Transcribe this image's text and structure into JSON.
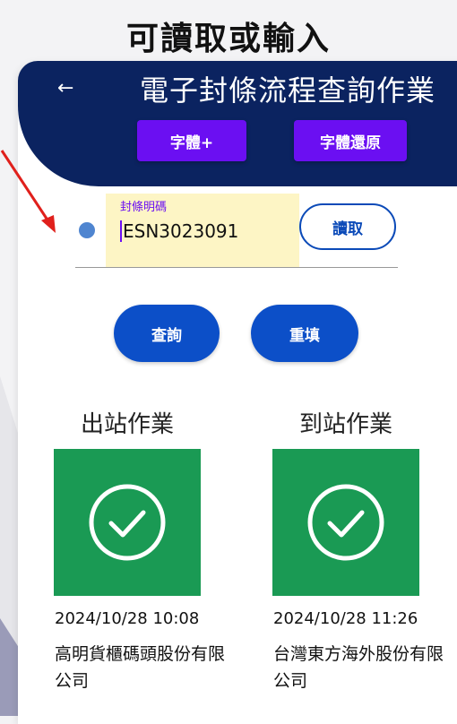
{
  "caption": "可讀取或輸入",
  "header": {
    "title": "電子封條流程查詢作業",
    "font_plus_label": "字體+",
    "font_reset_label": "字體還原"
  },
  "seal_field": {
    "label": "封條明碼",
    "value": "ESN3023091"
  },
  "read_button_label": "讀取",
  "query_button_label": "查詢",
  "reset_button_label": "重填",
  "steps": [
    {
      "title": "出站作業",
      "datetime": "2024/10/28 10:08",
      "company": "高明貨櫃碼頭股份有限公司",
      "status_icon": "check-circle-icon"
    },
    {
      "title": "到站作業",
      "datetime": "2024/10/28 11:26",
      "company": "台灣東方海外股份有限公司",
      "status_icon": "check-circle-icon"
    }
  ],
  "colors": {
    "header": "#0b2360",
    "purple_button": "#6b0ff2",
    "blue_button": "#0c4fc8",
    "status_tile": "#1a9a54",
    "pointer_arrow": "#e0201c"
  }
}
